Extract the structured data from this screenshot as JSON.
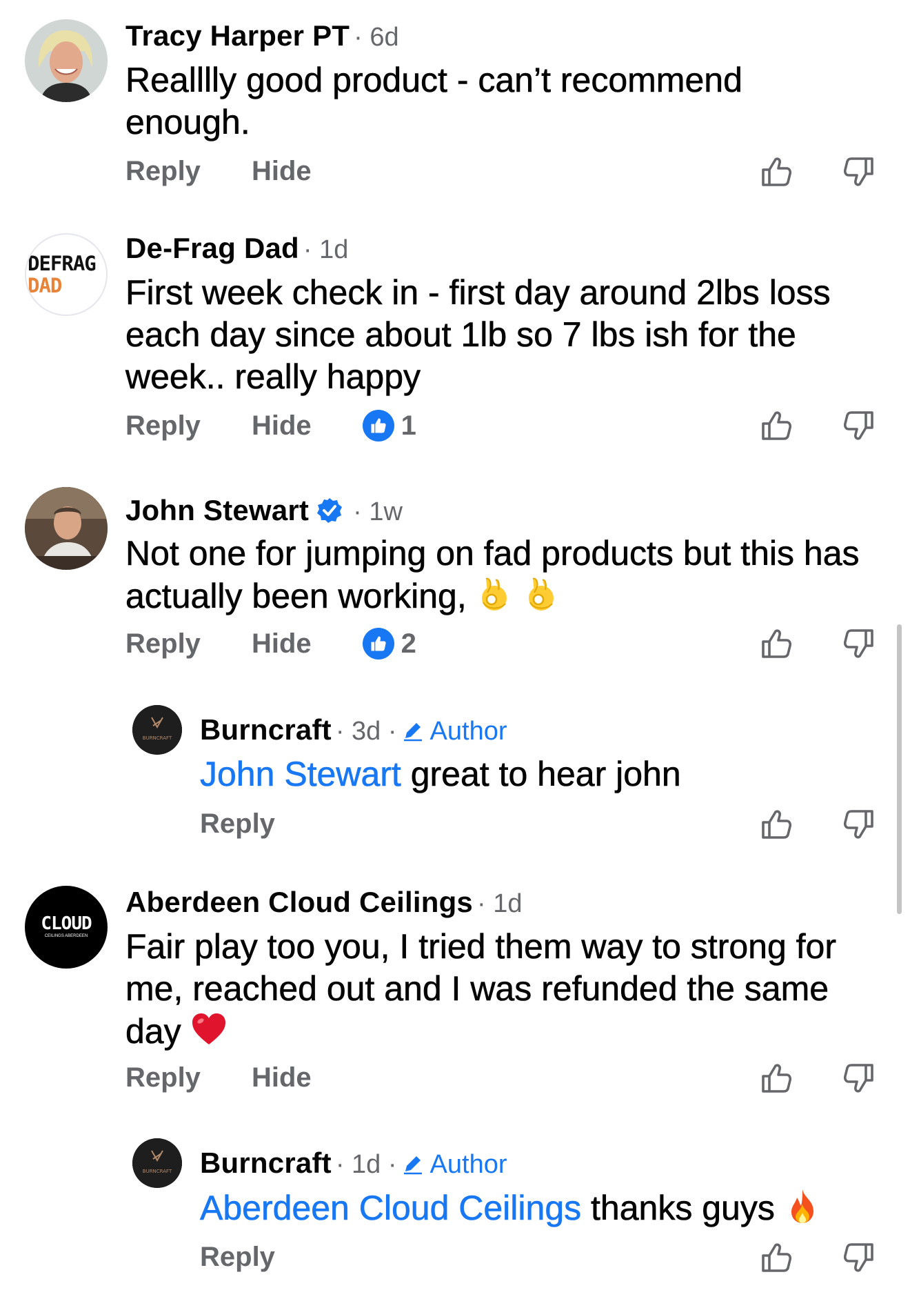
{
  "actions": {
    "reply": "Reply",
    "hide": "Hide",
    "author_label": "Author"
  },
  "comments": [
    {
      "name": "Tracy Harper PT",
      "time": "· 6d",
      "text": "Realllly good product - can’t recommend enough.",
      "avatar": "photo-woman-blonde"
    },
    {
      "name": "De-Frag Dad",
      "time": "· 1d",
      "text": "First week check in - first day around 2lbs loss each day since about 1lb so 7 lbs ish for the week.. really happy",
      "avatar_line1": "DEFRAG",
      "avatar_line2": "DAD",
      "like_count": "1"
    },
    {
      "name": "John Stewart",
      "time": "· 1w",
      "text": "Not one for jumping on fad products but this has actually been working,",
      "verified": true,
      "avatar": "photo-man-cafe",
      "like_count": "2",
      "reply": {
        "name": "Burncraft",
        "time": "· 3d ·",
        "mention": "John Stewart",
        "text": " great to hear john",
        "avatar_text": "BURNCRAFT"
      }
    },
    {
      "name": "Aberdeen Cloud Ceilings",
      "time": "· 1d",
      "text": "Fair play too you, I tried them way to strong for me, reached out and I was refunded the same day",
      "avatar_line1": "CLOUD",
      "avatar_line2": "CEILINGS ABERDEEN",
      "reply": {
        "name": "Burncraft",
        "time": "· 1d ·",
        "mention": "Aberdeen Cloud Ceilings",
        "text": " thanks guys",
        "avatar_text": "BURNCRAFT"
      }
    }
  ],
  "colors": {
    "link": "#1877f2",
    "muted": "#65676b",
    "text": "#050505"
  }
}
